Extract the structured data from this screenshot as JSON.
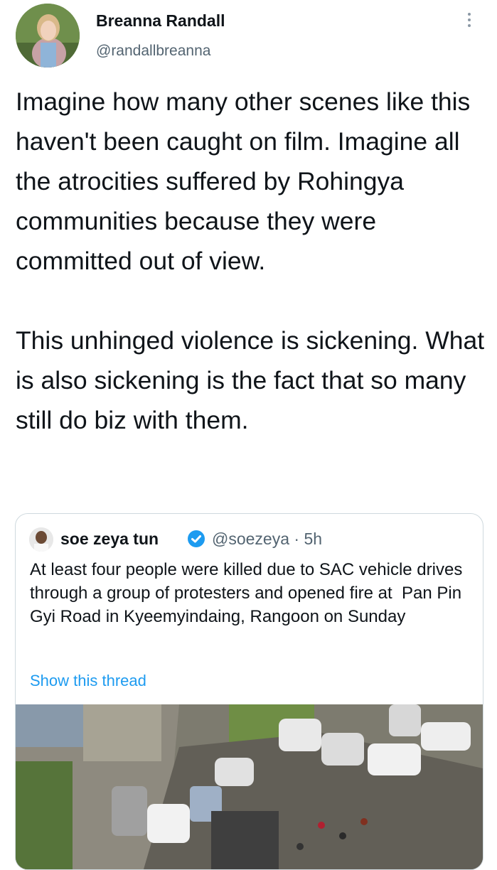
{
  "tweet": {
    "author_name": "Breanna Randall",
    "author_handle": "@randallbreanna",
    "text": "Imagine how many other scenes like this haven't been caught on film. Imagine all the atrocities suffered by Rohingya communities because they were committed out of view.\n\nThis unhinged violence is sickening. What is also sickening is the fact that so many still do biz with them.",
    "more_icon": "more-vertical-icon"
  },
  "quoted_tweet": {
    "author_name": "soe zeya tun",
    "verified_icon": "verified-badge-icon",
    "author_handle": "@soezeya · 5h",
    "text": "At least four people were killed due to SAC vehicle drives through a group of protesters and opened fire at  Pan Pin Gyi Road in Kyeemyindaing, Rangoon on Sunday",
    "show_thread": "Show this thread"
  },
  "colors": {
    "link": "#1d9bf0",
    "secondary": "#536471",
    "border": "#cfd9de"
  }
}
